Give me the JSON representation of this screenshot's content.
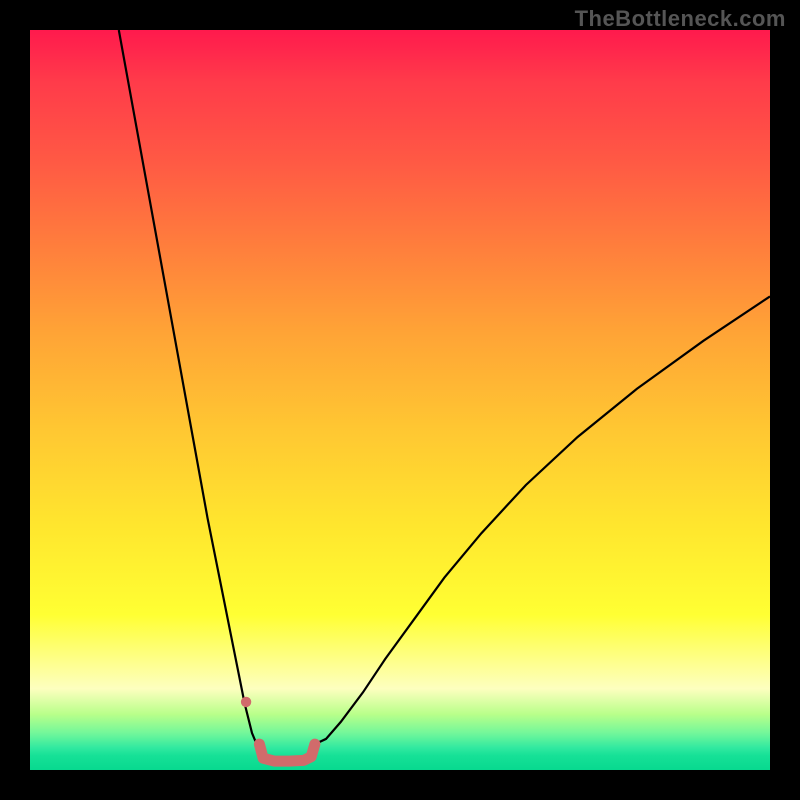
{
  "watermark": "TheBottleneck.com",
  "chart_data": {
    "type": "line",
    "title": "",
    "xlabel": "",
    "ylabel": "",
    "xlim": [
      0,
      100
    ],
    "ylim": [
      0,
      100
    ],
    "grid": false,
    "legend": false,
    "annotations": [],
    "series": [
      {
        "name": "curve-left",
        "color": "#000000",
        "stroke_width": 2.2,
        "x": [
          12,
          14,
          16,
          18,
          20,
          22,
          24,
          26,
          28,
          29,
          30,
          30.5,
          31
        ],
        "y": [
          100,
          89,
          78,
          67,
          56,
          45,
          34,
          24,
          14,
          9,
          5,
          3.8,
          3.5
        ]
      },
      {
        "name": "curve-right",
        "color": "#000000",
        "stroke_width": 2.2,
        "x": [
          38.5,
          40,
          42,
          45,
          48,
          52,
          56,
          61,
          67,
          74,
          82,
          91,
          100
        ],
        "y": [
          3.5,
          4.2,
          6.5,
          10.5,
          15,
          20.5,
          26,
          32,
          38.5,
          45,
          51.5,
          58,
          64
        ]
      },
      {
        "name": "floor-pink",
        "color": "#d16b6b",
        "stroke_width": 11,
        "linecap": "round",
        "x": [
          31,
          31.5,
          33,
          35,
          37,
          38,
          38.5
        ],
        "y": [
          3.5,
          1.6,
          1.2,
          1.2,
          1.3,
          1.8,
          3.5
        ]
      }
    ],
    "markers": [
      {
        "name": "pink-dot",
        "color": "#d16b6b",
        "x": 29.2,
        "y": 9.2,
        "r": 5.2
      }
    ]
  }
}
